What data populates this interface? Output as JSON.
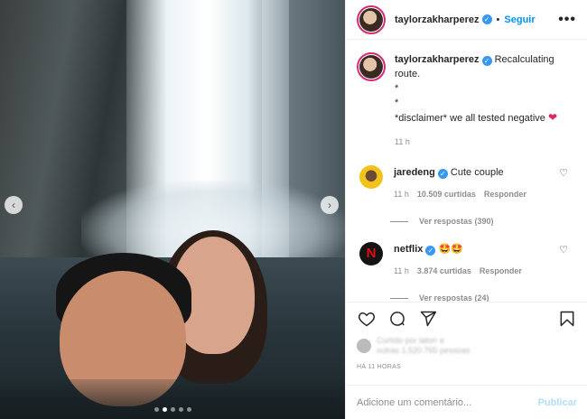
{
  "post": {
    "username": "taylorzakharperez",
    "follow_label": "Seguir",
    "more_label": "•••",
    "caption_lines": [
      "Recalculating",
      "route.",
      "*",
      "*",
      "*disclaimer* we all tested negative"
    ],
    "caption_emoji": "❤",
    "caption_time": "11 h"
  },
  "comments": [
    {
      "username": "jaredeng",
      "text": "Cute couple",
      "time": "11 h",
      "likes": "10.509 curtidas",
      "reply_label": "Responder",
      "view_replies": "Ver respostas (390)"
    },
    {
      "username": "netflix",
      "text": "🤩🤩",
      "time": "11 h",
      "likes": "3.874 curtidas",
      "reply_label": "Responder",
      "view_replies": "Ver respostas (24)"
    }
  ],
  "likes_summary": {
    "line1": "Curtido por latorr e",
    "line2": "outras 1.520.765 pessoas"
  },
  "date_label": "HÁ 11 HORAS",
  "add_comment": {
    "placeholder": "Adicione um comentário...",
    "publish_label": "Publicar"
  },
  "media": {
    "nav_prev": "‹",
    "nav_next": "›",
    "carousel_count": 5,
    "carousel_active": 1
  },
  "colors": {
    "accent": "#0095f6",
    "verified": "#3897f0",
    "publish_disabled": "#b2dffc",
    "avatar_ring": "#d62976"
  }
}
